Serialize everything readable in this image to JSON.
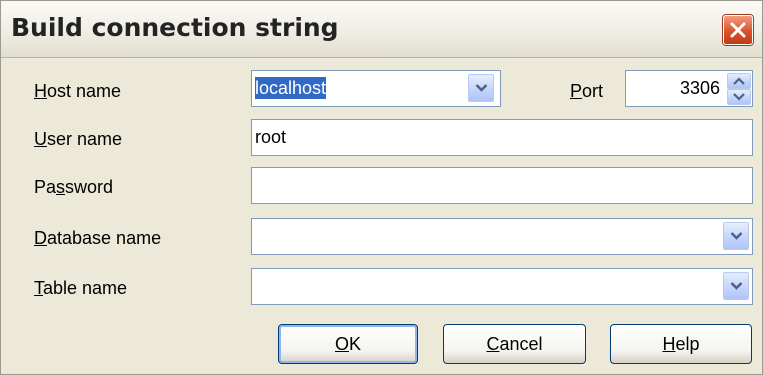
{
  "dialog": {
    "title": "Build connection string"
  },
  "host": {
    "label_ul": "H",
    "label_rest": "ost name",
    "value": "localhost"
  },
  "port": {
    "label_ul": "P",
    "label_rest": "ort",
    "value": "3306"
  },
  "user": {
    "label_ul": "U",
    "label_rest": "ser name",
    "value": "root"
  },
  "password": {
    "label_pre": "Pa",
    "label_ul": "s",
    "label_rest": "sword",
    "value": ""
  },
  "database": {
    "label_ul": "D",
    "label_rest": "atabase name",
    "value": ""
  },
  "table": {
    "label_ul": "T",
    "label_rest": "able name",
    "value": ""
  },
  "buttons": {
    "ok": {
      "ul": "O",
      "rest": "K"
    },
    "cancel": {
      "ul": "C",
      "rest": "ancel"
    },
    "help": {
      "ul": "H",
      "rest": "elp"
    }
  },
  "icons": {
    "close": "close-x-icon",
    "dropdown": "chevron-down-icon",
    "spin_up": "spin-up-icon",
    "spin_down": "spin-down-icon"
  },
  "colors": {
    "dialog_bg": "#ece9d8",
    "close_button": "#d9522d",
    "selection": "#316ac5",
    "field_border": "#7f9db9"
  }
}
